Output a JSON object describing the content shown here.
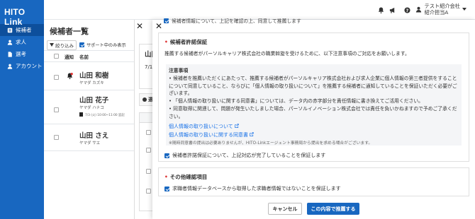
{
  "app": {
    "logo": "HITO Link"
  },
  "sidebar": {
    "items": [
      {
        "label": "候補者",
        "icon": "person-card-icon",
        "active": true
      },
      {
        "label": "求人",
        "icon": "user-icon",
        "active": false
      },
      {
        "label": "選考",
        "icon": "file-icon",
        "active": false
      },
      {
        "label": "アカウント",
        "icon": "user-icon",
        "active": false
      }
    ]
  },
  "header": {
    "user_company": "テスト紹介会社",
    "user_name": "紹介担当A",
    "top_truncated": "候補者情報について、上記を確認の上、同意して推薦します"
  },
  "list": {
    "title": "候補者一覧",
    "filter_label": "絞り込み",
    "support_only_label": "サポート中のみ表示",
    "col_notify": "通知",
    "col_name": "名前",
    "rows": [
      {
        "name": "山田 和樹",
        "kana": "ヤマダ カズキ",
        "meta": ""
      },
      {
        "name": "山田 花子",
        "kana": "ヤマダ ハナコ",
        "meta": "7/3 (火) 10:00~11:00 追記"
      },
      {
        "name": "山田 さえ",
        "kana": "ヤマダ サエ",
        "meta": ""
      }
    ]
  },
  "middle": {
    "title_partial": "山田",
    "date_partial": "7/1",
    "tab_partial": "選"
  },
  "modal": {
    "section1": {
      "title": "候補者許諾保証",
      "lead": "推薦する候補者がパーソルキャリア株式会社の職業斡旋を受けるために、以下注意事項のご対応をお願いします。",
      "notice_heading": "注意事項",
      "notice_items": [
        "候補者を推薦いただくにあたって、推薦する候補者がパーソルキャリア株式会社および求人企業に個人情報の第三者提供をすることについて同意していること、ならびに「個人情報の取り扱いについて」を推薦する候補者に通知していることを保証いただく必要がございます。",
        "「個人情報の取り扱いに関する同意書」については、データ内の赤字部分を責任情報に書き換えてご活用ください。",
        "同意取得に関連して、問題が発生いたしました場合、パーソルイノベーション株式会社では責任を負いかねますので予めご了承ください。"
      ],
      "link1": "個人情報の取り扱いについて",
      "link2": "個人情報の取り扱いに関する同意書",
      "footnote": "※随時同意書の提出は必要ありませんが、HITO-Linkエージェント事務局から提出を求める場合がございます。",
      "confirm_label": "候補者許諾保証について、上記対応が完了していることを保証します",
      "confirm_checked": true
    },
    "section2": {
      "title": "その他確認項目",
      "confirm_label": "求職者情報データベースから取得した求職者情報ではないことを保証します",
      "confirm_checked": true
    },
    "cancel_label": "キャンセル",
    "submit_label": "この内容で推薦する"
  },
  "colors": {
    "brand": "#1867c0",
    "sidebar_active": "#0d4f9c",
    "required_bullet": "#dd3333",
    "link": "#1a73e8"
  }
}
